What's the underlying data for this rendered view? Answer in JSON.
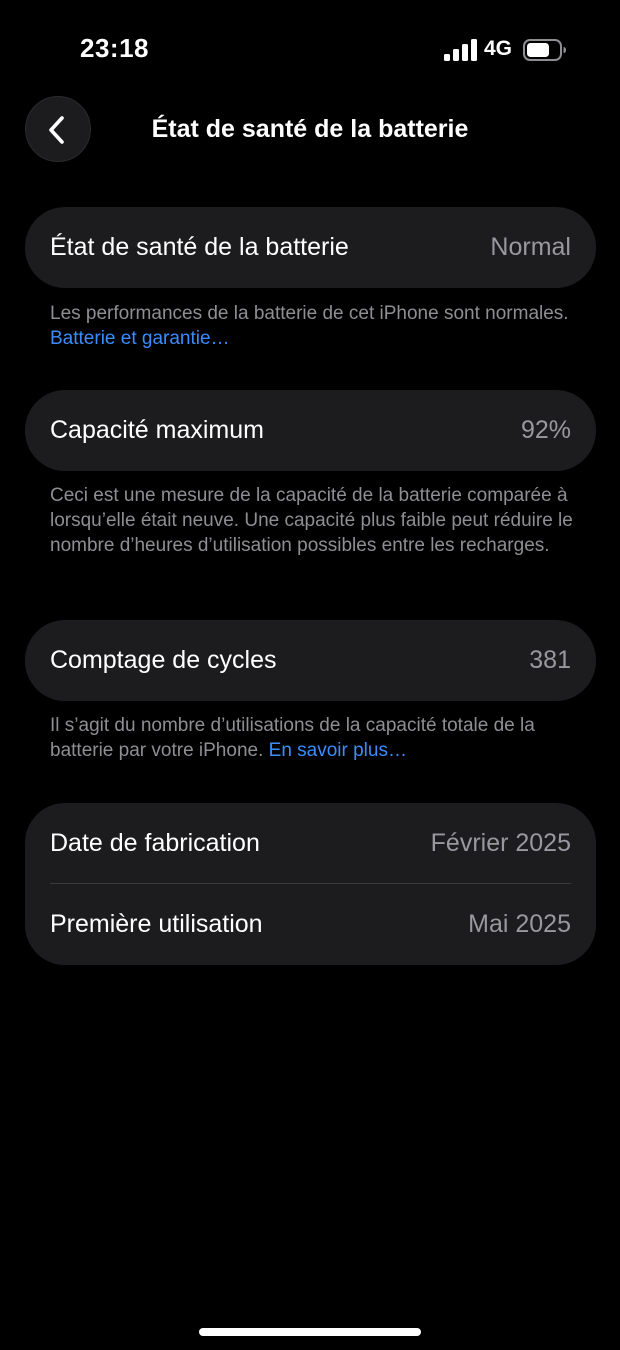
{
  "status_bar": {
    "time": "23:18",
    "network": "4G",
    "signal_icon": "cellular-signal-icon",
    "battery_icon": "battery-icon",
    "battery_level": 0.7
  },
  "nav": {
    "back_icon": "chevron-left-icon",
    "title": "État de santé de la batterie"
  },
  "health": {
    "label": "État de santé de la batterie",
    "value": "Normal",
    "footnote_text": "Les performances de la batterie de cet iPhone sont normales. ",
    "footnote_link": "Batterie et garantie…"
  },
  "capacity": {
    "label": "Capacité maximum",
    "value": "92%",
    "footnote_text": "Ceci est une mesure de la capacité de la batterie comparée à lorsqu’elle était neuve. Une capacité plus faible peut réduire le nombre d’heures d’utilisation possibles entre les recharges."
  },
  "cycles": {
    "label": "Comptage de cycles",
    "value": "381",
    "footnote_text": "Il s’agit du nombre d’utilisations de la capacité totale de la batterie par votre iPhone. ",
    "footnote_link": "En savoir plus…"
  },
  "dates": {
    "manufacture_label": "Date de fabrication",
    "manufacture_value": "Février 2025",
    "first_use_label": "Première utilisation",
    "first_use_value": "Mai 2025"
  },
  "colors": {
    "background": "#000000",
    "card": "#1c1c1e",
    "secondary_text": "#8e8e93",
    "link": "#3b8cff"
  }
}
